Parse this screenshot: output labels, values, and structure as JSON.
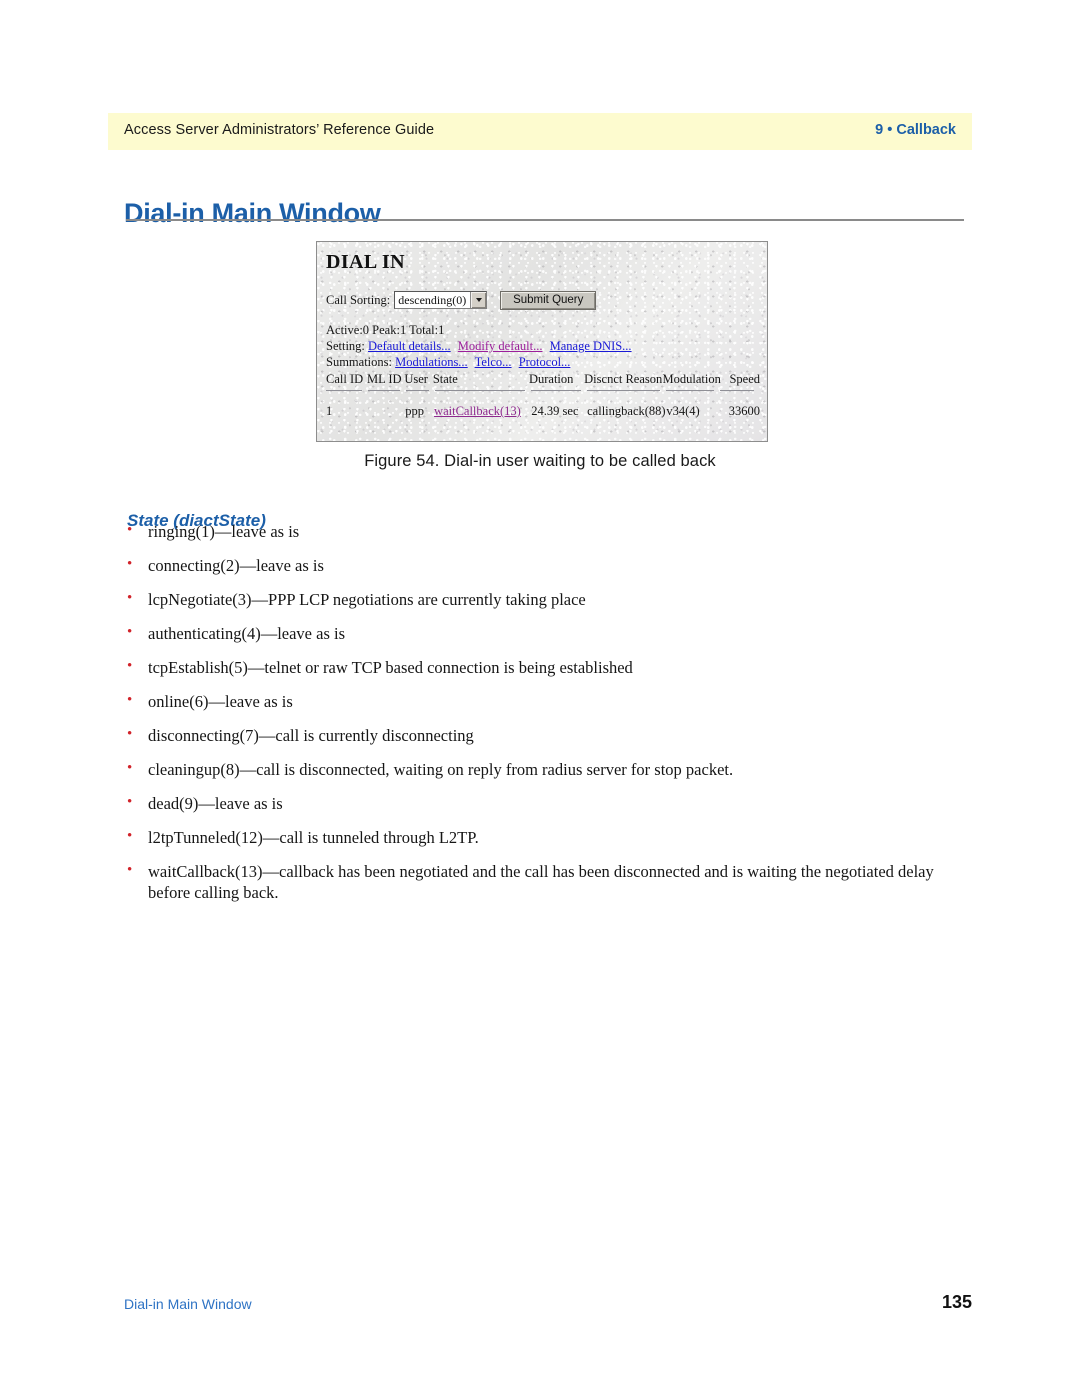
{
  "page": {
    "running_header_left": "Access Server Administrators’ Reference Guide",
    "running_header_right": "9 • Callback",
    "title": "Dial-in Main Window",
    "footer_left": "Dial-in Main Window",
    "footer_page_number": "135",
    "accent_color": "#1c5fa8",
    "header_band_color": "#fdfbcf",
    "bullet_color": "#d1232a"
  },
  "figure": {
    "caption": "Figure 54. Dial-in user waiting to be called back",
    "screenshot": {
      "app_title": "DIAL IN",
      "controls": {
        "call_sorting_label": "Call Sorting:",
        "call_sorting_value": "descending(0)",
        "call_sorting_options": [
          "descending(0)"
        ],
        "submit_label": "Submit Query",
        "dropdown_arrow_icon": "chevron-down-icon"
      },
      "stats_line": "Active:0 Peak:1 Total:1",
      "setting_label": "Setting:",
      "setting_links": [
        {
          "label": "Default details...",
          "visited": false
        },
        {
          "label": "Modify default...",
          "visited": true
        },
        {
          "label": "Manage DNIS...",
          "visited": false
        }
      ],
      "summations_label": "Summations:",
      "summations_links": [
        {
          "label": "Modulations...",
          "visited": false
        },
        {
          "label": "Telco...",
          "visited": false
        },
        {
          "label": "Protocol...",
          "visited": false
        }
      ],
      "table": {
        "columns": [
          "Call ID",
          "ML ID",
          "User",
          "State",
          "Duration",
          "Discnct Reason",
          "Modulation",
          "Speed"
        ],
        "rows": [
          {
            "call_id": "1",
            "ml_id": "",
            "user": "ppp",
            "state": "waitCallback(13)",
            "state_is_link": true,
            "duration": "24.39 sec",
            "discnct_reason": "callingback(88)",
            "modulation": "v34(4)",
            "speed": "33600"
          }
        ]
      }
    }
  },
  "section": {
    "heading": "State (diactState)",
    "bullets": [
      "ringing(1)—leave as is",
      "connecting(2)—leave as is",
      "lcpNegotiate(3)—PPP LCP negotiations are currently taking place",
      "authenticating(4)—leave as is",
      "tcpEstablish(5)—telnet or raw TCP based connection is being established",
      "online(6)—leave as is",
      "disconnecting(7)—call is currently disconnecting",
      "cleaningup(8)—call is disconnected, waiting on reply from radius server for stop packet.",
      "dead(9)—leave as is",
      "l2tpTunneled(12)—call is tunneled through L2TP.",
      "waitCallback(13)—callback has been negotiated and the call has been disconnected and is waiting the negotiated delay before calling back."
    ]
  }
}
